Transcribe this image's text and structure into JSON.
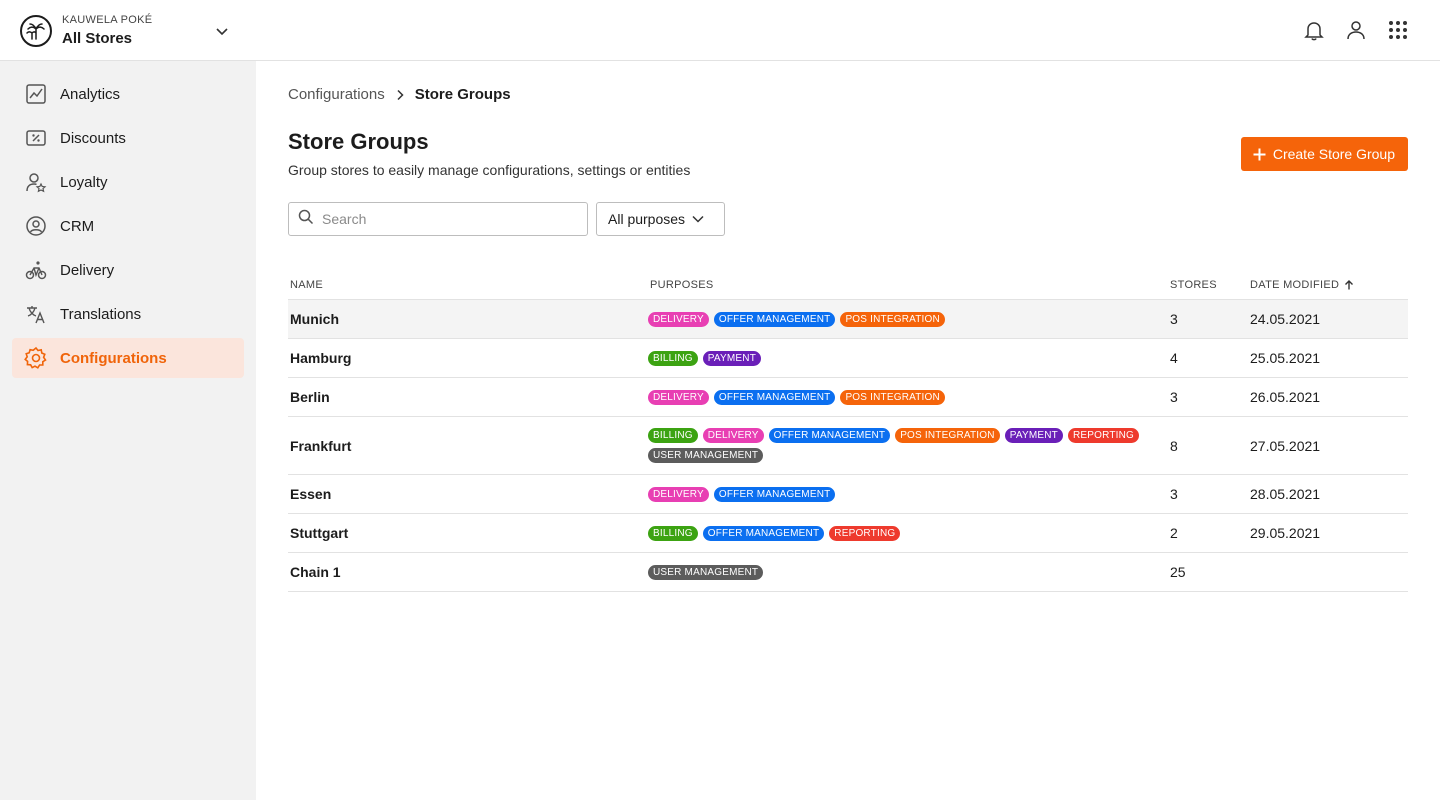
{
  "topbar": {
    "brand": "KAUWELA POKÉ",
    "store": "All Stores"
  },
  "sidebar": {
    "items": [
      {
        "label": "Analytics",
        "icon": "analytics-icon"
      },
      {
        "label": "Discounts",
        "icon": "discount-icon"
      },
      {
        "label": "Loyalty",
        "icon": "loyalty-icon"
      },
      {
        "label": "CRM",
        "icon": "crm-icon"
      },
      {
        "label": "Delivery",
        "icon": "bike-icon"
      },
      {
        "label": "Translations",
        "icon": "translate-icon"
      },
      {
        "label": "Configurations",
        "icon": "gear-icon",
        "active": true
      }
    ]
  },
  "breadcrumb": {
    "parent": "Configurations",
    "current": "Store Groups"
  },
  "page": {
    "title": "Store Groups",
    "subtitle": "Group stores to easily manage configurations, settings or entities",
    "create_label": "Create Store Group"
  },
  "filters": {
    "search_placeholder": "Search",
    "purpose_selected": "All purposes"
  },
  "table": {
    "headers": {
      "name": "NAME",
      "purposes": "PURPOSES",
      "stores": "STORES",
      "date": "DATE MODIFIED"
    },
    "rows": [
      {
        "name": "Munich",
        "purposes": [
          "DELIVERY",
          "OFFER MANAGEMENT",
          "POS INTEGRATION"
        ],
        "stores": "3",
        "date": "24.05.2021"
      },
      {
        "name": "Hamburg",
        "purposes": [
          "BILLING",
          "PAYMENT"
        ],
        "stores": "4",
        "date": "25.05.2021"
      },
      {
        "name": "Berlin",
        "purposes": [
          "DELIVERY",
          "OFFER MANAGEMENT",
          "POS INTEGRATION"
        ],
        "stores": "3",
        "date": "26.05.2021"
      },
      {
        "name": "Frankfurt",
        "purposes": [
          "BILLING",
          "DELIVERY",
          "OFFER MANAGEMENT",
          "POS INTEGRATION",
          "PAYMENT",
          "REPORTING",
          "USER MANAGEMENT"
        ],
        "stores": "8",
        "date": "27.05.2021"
      },
      {
        "name": "Essen",
        "purposes": [
          "DELIVERY",
          "OFFER MANAGEMENT"
        ],
        "stores": "3",
        "date": "28.05.2021"
      },
      {
        "name": "Stuttgart",
        "purposes": [
          "BILLING",
          "OFFER MANAGEMENT",
          "REPORTING"
        ],
        "stores": "2",
        "date": "29.05.2021"
      },
      {
        "name": "Chain 1",
        "purposes": [
          "USER MANAGEMENT"
        ],
        "stores": "25",
        "date": ""
      }
    ]
  },
  "tag_colors": {
    "DELIVERY": "#e83fb3",
    "OFFER MANAGEMENT": "#0b6ff0",
    "POS INTEGRATION": "#f5640a",
    "BILLING": "#3ca312",
    "PAYMENT": "#6a1fb8",
    "REPORTING": "#ee3a2d",
    "USER MANAGEMENT": "#5c5c5c"
  },
  "colors": {
    "accent": "#f5640a",
    "active_nav_bg": "#fbe5dc"
  }
}
